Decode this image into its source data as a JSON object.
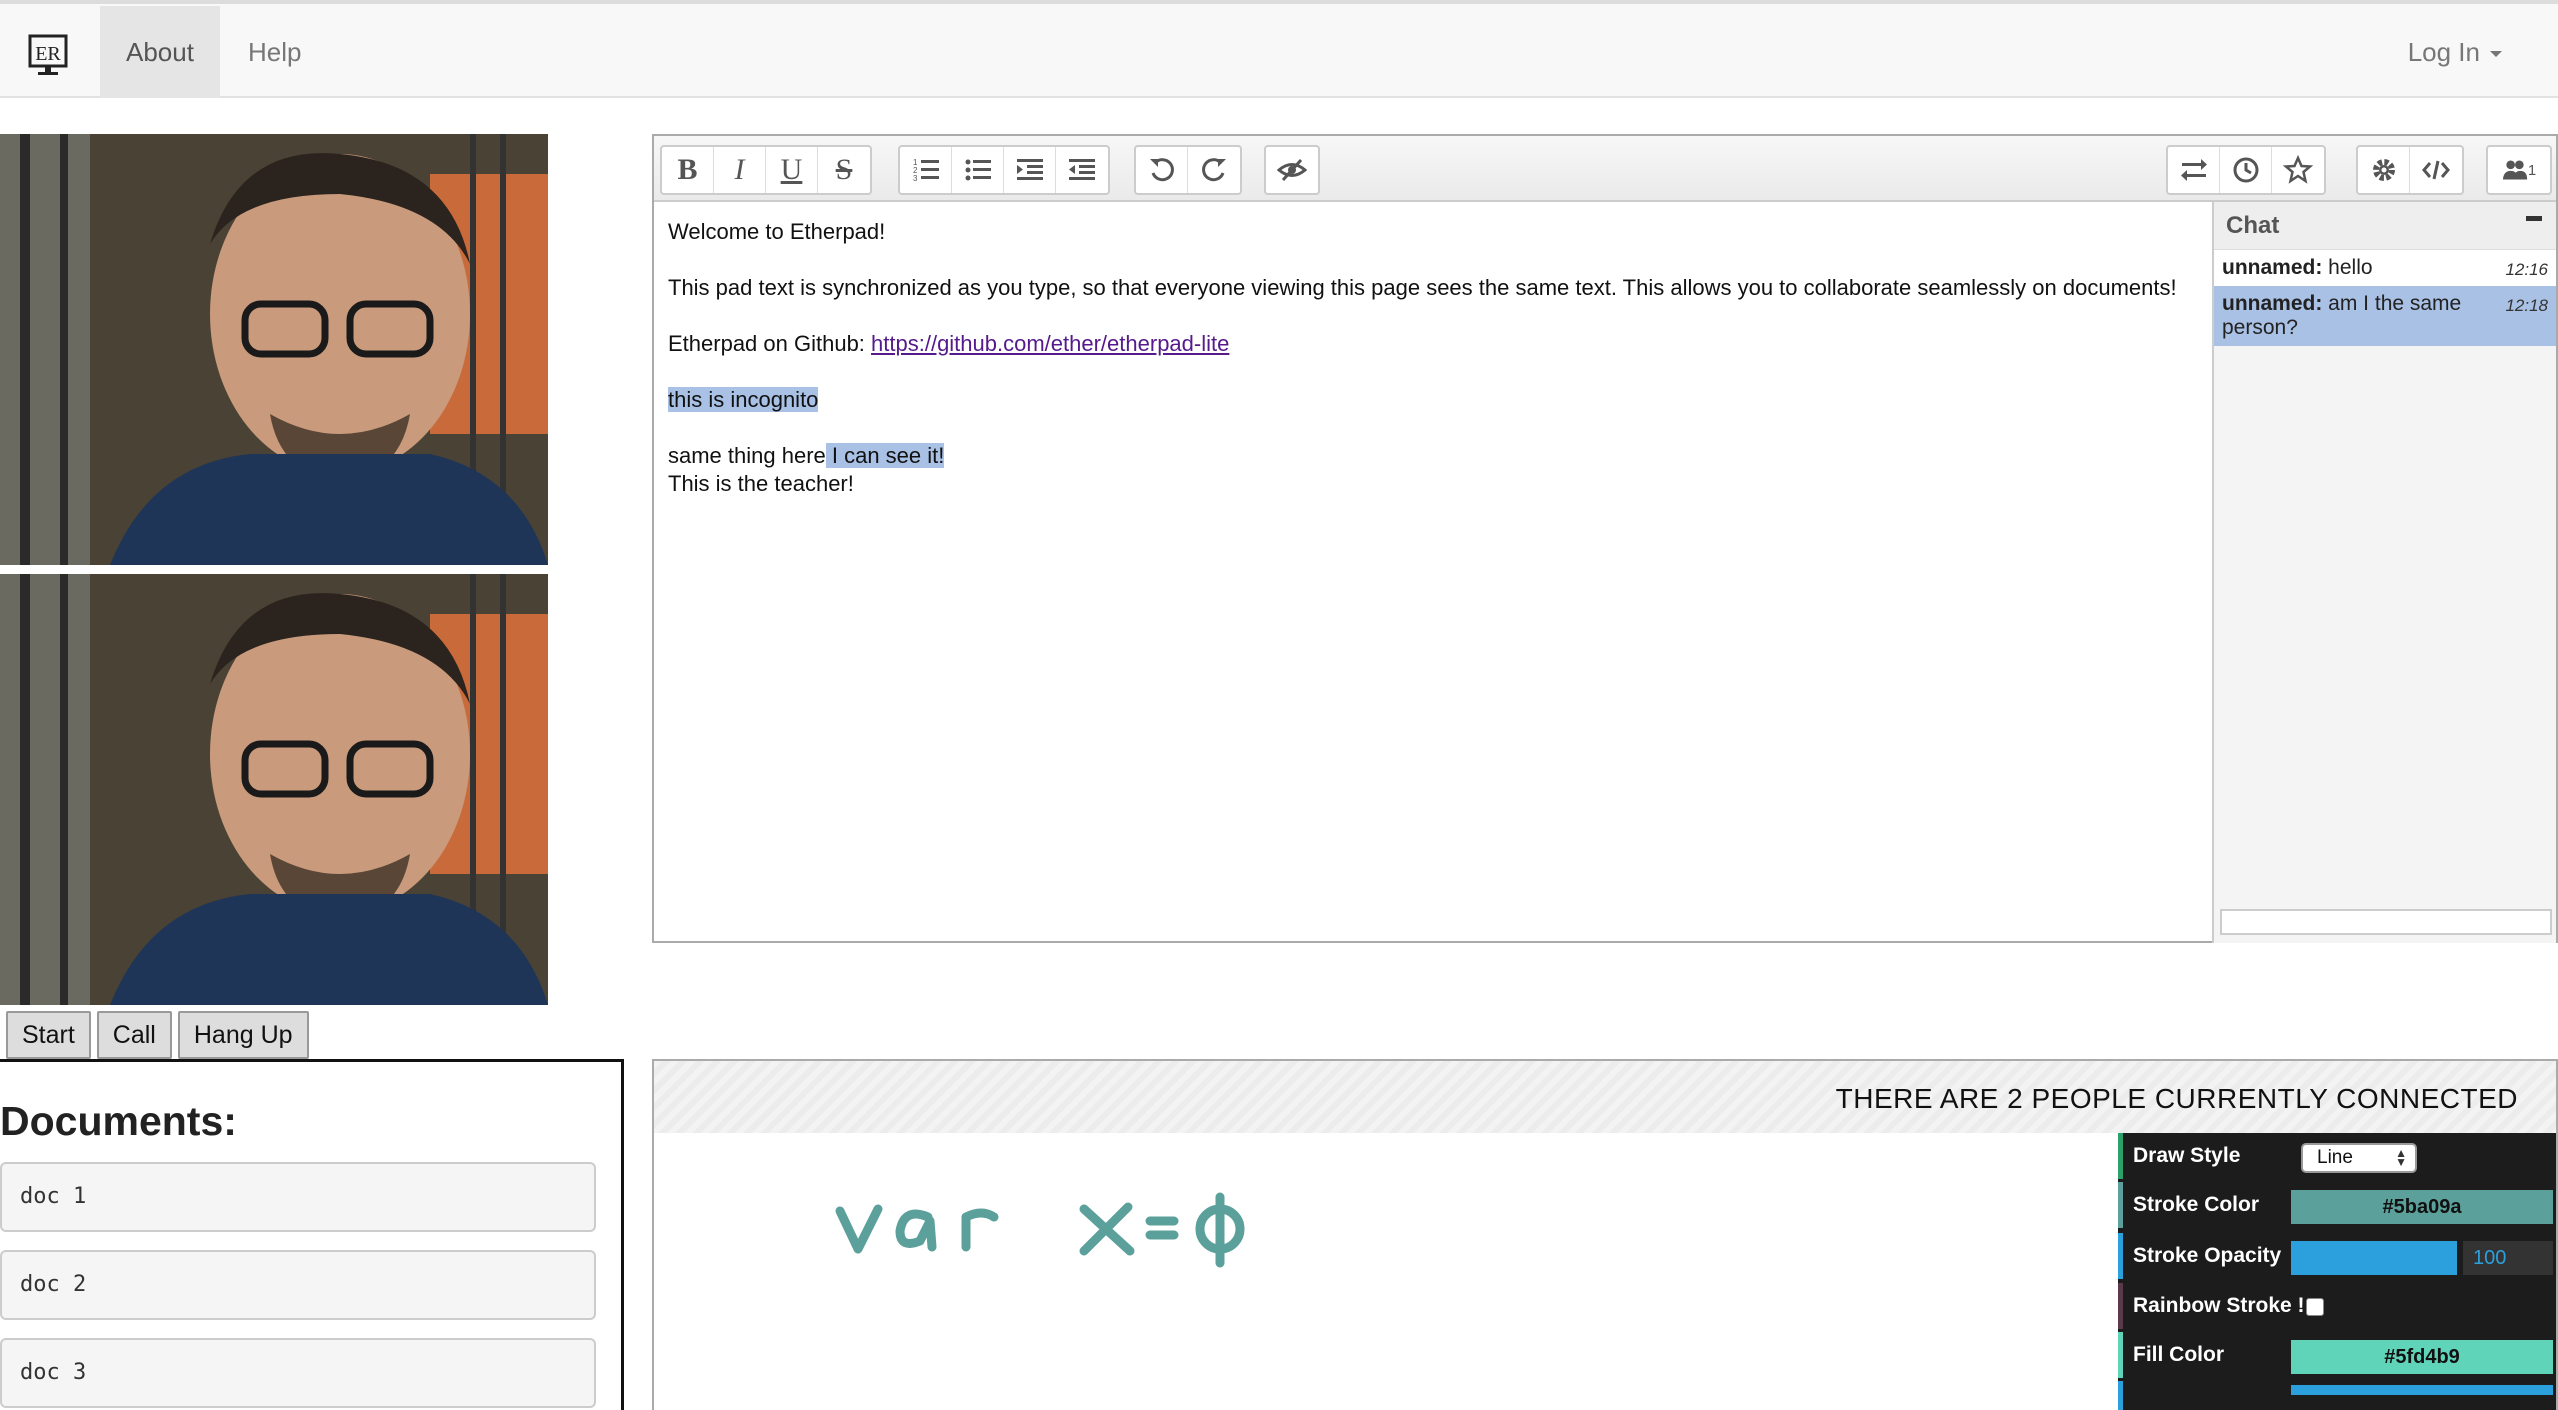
{
  "navbar": {
    "brand": "ER",
    "items": [
      {
        "label": "About",
        "active": true
      },
      {
        "label": "Help",
        "active": false
      }
    ],
    "login_label": "Log In"
  },
  "video": {
    "buttons": [
      "Start",
      "Call",
      "Hang Up"
    ]
  },
  "documents": {
    "title": "Documents:",
    "items": [
      "doc 1",
      "doc 2",
      "doc 3"
    ]
  },
  "pad": {
    "toolbar": {
      "left": [
        "bold-icon",
        "italic-icon",
        "underline-icon",
        "strikethrough-icon",
        "ordered-list-icon",
        "unordered-list-icon",
        "indent-icon",
        "outdent-icon",
        "undo-icon",
        "redo-icon",
        "clear-authorship-icon"
      ],
      "right": [
        "import-export-icon",
        "timeslider-icon",
        "saved-revision-icon",
        "settings-icon",
        "embed-icon",
        "users-icon"
      ],
      "user_count": "1"
    },
    "lines": {
      "welcome": "Welcome to Etherpad!",
      "sync": "This pad text is synchronized as you type, so that everyone viewing this page sees the same text. This allows you to collaborate seamlessly on documents!",
      "github_prefix": "Etherpad on Github: ",
      "github_link": "https://github.com/ether/etherpad-lite",
      "incognito": "this is incognito",
      "same_prefix": "same thing here",
      "same_highlight": " I can see it!",
      "teacher": "This is the teacher!"
    },
    "chat": {
      "title": "Chat",
      "messages": [
        {
          "author": "unnamed:",
          "text": " hello",
          "time": "12:16",
          "highlighted": false
        },
        {
          "author": "unnamed:",
          "text": " am I the same person?",
          "time": "12:18",
          "highlighted": true
        }
      ]
    }
  },
  "board": {
    "banner": "THERE ARE 2 PEOPLE CURRENTLY CONNECTED",
    "drawing_color": "#5ba09a",
    "settings": {
      "draw_style_label": "Draw Style",
      "draw_style_value": "Line",
      "stroke_color_label": "Stroke Color",
      "stroke_color_value": "#5ba09a",
      "stroke_opacity_label": "Stroke Opacity",
      "stroke_opacity_value": "100",
      "rainbow_label": "Rainbow Stroke !",
      "rainbow_checked": false,
      "fill_color_label": "Fill Color",
      "fill_color_value": "#5fd4b9",
      "accent_blue": "#2ba0dc"
    }
  }
}
